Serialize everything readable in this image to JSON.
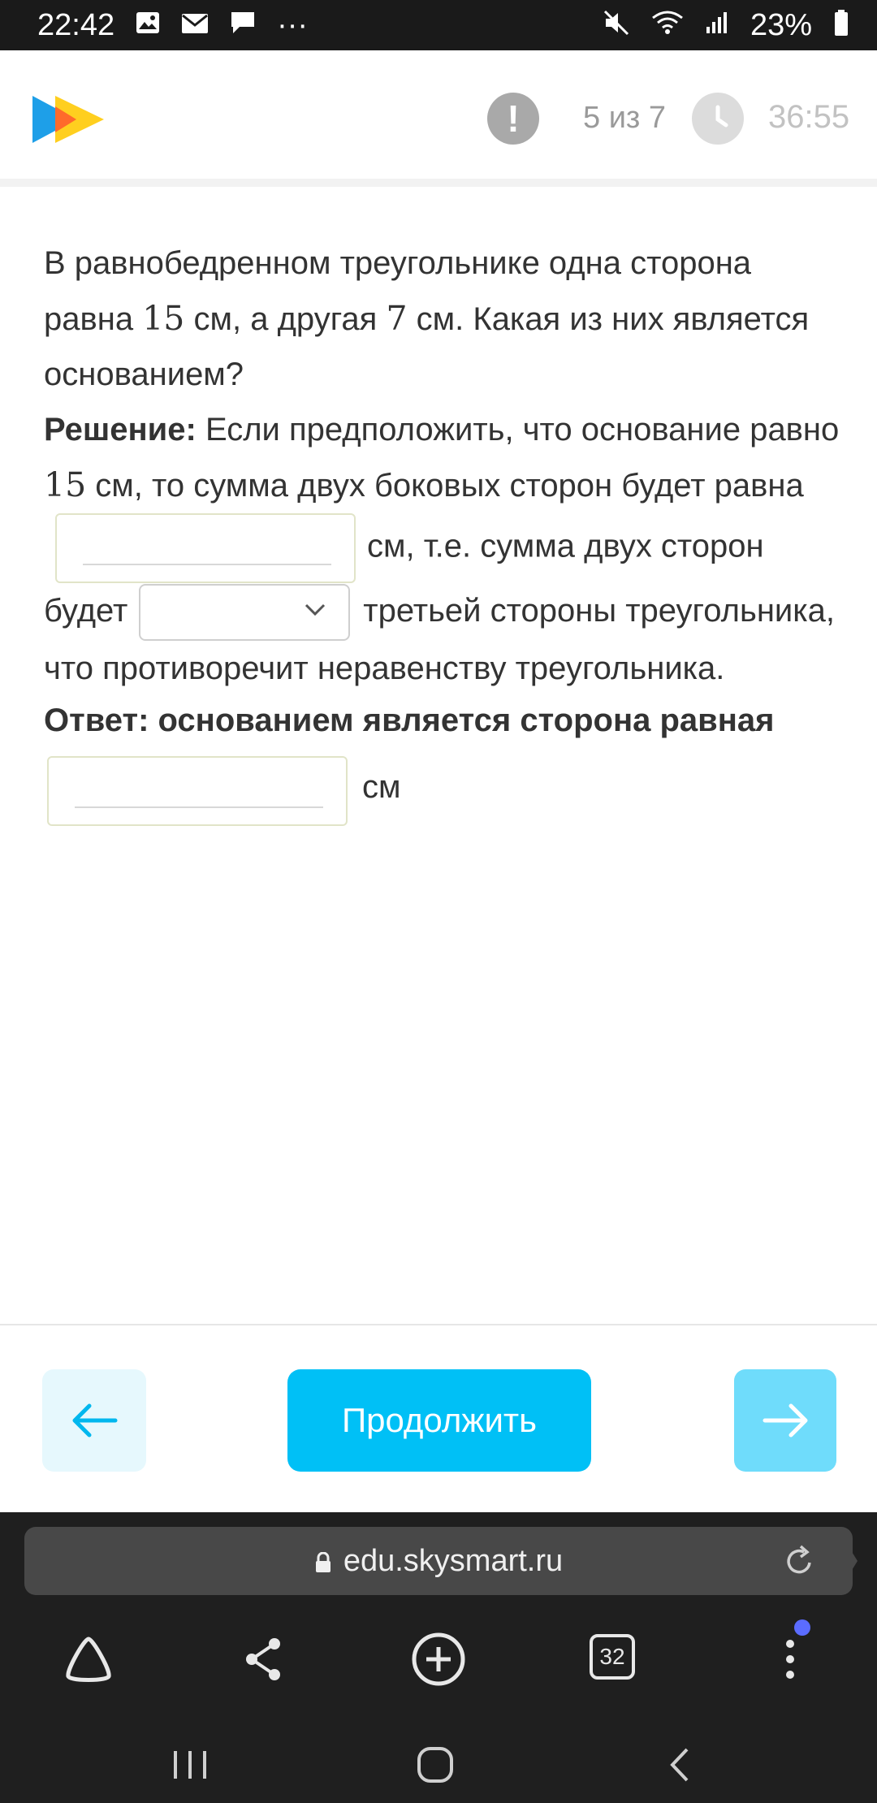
{
  "status_bar": {
    "time": "22:42",
    "more": "···",
    "battery": "23%",
    "icons": [
      "image-icon",
      "mail-icon",
      "chat-icon",
      "mute-icon",
      "wifi-icon",
      "signal-icon",
      "battery-icon"
    ]
  },
  "header": {
    "logo": "skysmart-logo",
    "progress": "5 из 7",
    "timer": "36:55"
  },
  "task": {
    "question_part1": "В равнобедренном треугольнике одна сторона равна ",
    "question_num1": "15",
    "question_part2": " см, а другая ",
    "question_num2": "7",
    "question_part3": " см. Какая из них является основанием?",
    "solution_label": "Решение:",
    "solution_part1": " Если предположить, что основание равно ",
    "solution_num": "15",
    "solution_part2": " см, то сумма двух боковых сторон будет равна",
    "solution_part3": "см, т.е. сумма двух сторон будет",
    "solution_part4": "третьей стороны треугольника, что противоречит неравенству треугольника.",
    "answer_label": "Ответ: основанием является сторона равная",
    "answer_unit": "см",
    "sum_input_value": "",
    "compare_select_value": "",
    "answer_input_value": ""
  },
  "footer": {
    "continue_label": "Продолжить"
  },
  "browser": {
    "url": "edu.skysmart.ru",
    "tabs_count": "32"
  },
  "colors": {
    "accent": "#00c0f6",
    "accent_light": "#6fdcfb",
    "prev_bg": "#e6f8fd"
  }
}
